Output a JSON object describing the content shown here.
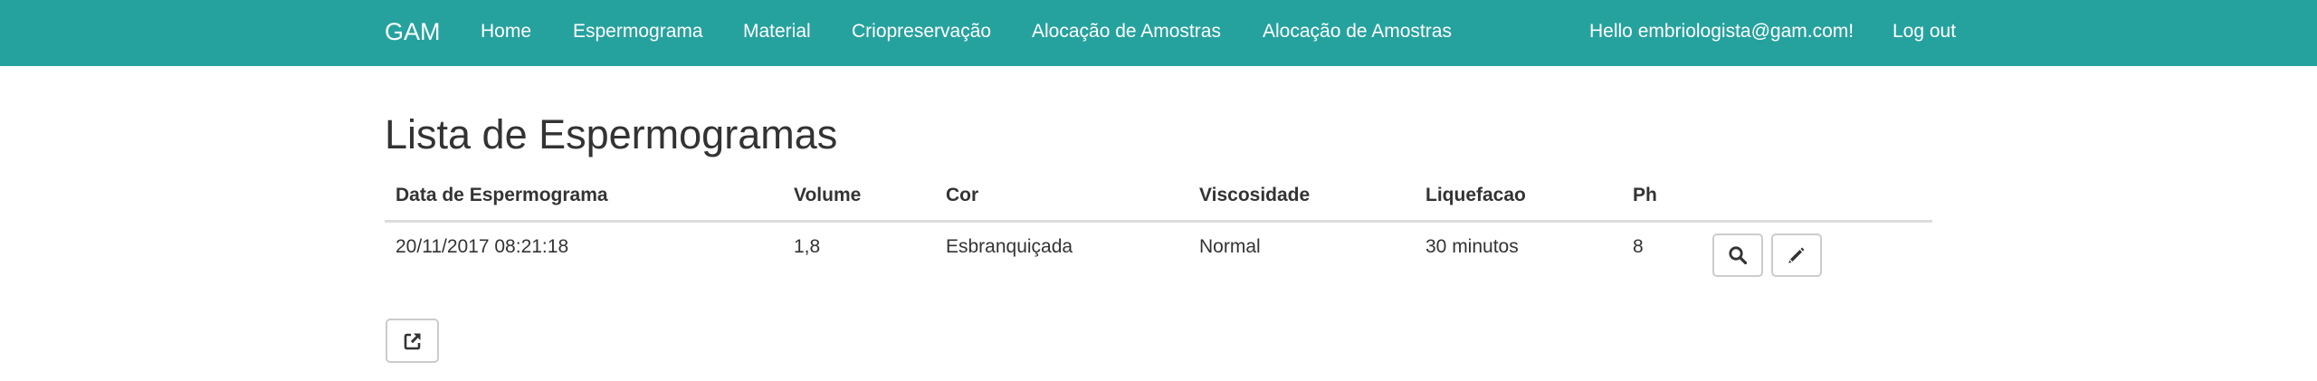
{
  "navbar": {
    "brand": "GAM",
    "items": [
      {
        "label": "Home"
      },
      {
        "label": "Espermograma"
      },
      {
        "label": "Material"
      },
      {
        "label": "Criopreservação"
      },
      {
        "label": "Alocação de Amostras"
      },
      {
        "label": "Alocação de Amostras"
      }
    ],
    "greeting": "Hello embriologista@gam.com!",
    "logout": "Log out"
  },
  "page": {
    "title": "Lista de Espermogramas"
  },
  "table": {
    "headers": [
      "Data de Espermograma",
      "Volume",
      "Cor",
      "Viscosidade",
      "Liquefacao",
      "Ph"
    ],
    "rows": [
      {
        "data": "20/11/2017 08:21:18",
        "volume": "1,8",
        "cor": "Esbranquiçada",
        "viscosidade": "Normal",
        "liquefacao": "30 minutos",
        "ph": "8",
        "actions": [
          {
            "icon": "search-icon"
          },
          {
            "icon": "pencil-icon"
          }
        ]
      }
    ]
  },
  "footer_actions": {
    "export_icon": "external-link-icon"
  },
  "colors": {
    "navbar": "#26a29e",
    "text": "#333333",
    "border": "#cccccc"
  }
}
